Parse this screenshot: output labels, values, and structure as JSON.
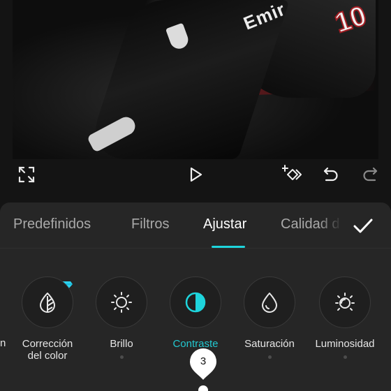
{
  "preview": {
    "jersey_text": "Emir",
    "jersey_number": "10"
  },
  "toolbar": {
    "fullscreen_icon": "fullscreen-icon",
    "play_icon": "play-icon",
    "keyframe_icon": "add-keyframe-icon",
    "undo_icon": "undo-icon",
    "redo_icon": "redo-icon"
  },
  "tabs": [
    {
      "label": "Predefinidos",
      "active": false
    },
    {
      "label": "Filtros",
      "active": false
    },
    {
      "label": "Ajustar",
      "active": true
    },
    {
      "label": "Calidad d",
      "active": false
    }
  ],
  "confirm_icon": "check-icon",
  "tools": {
    "partial_label": "n",
    "items": [
      {
        "label_line1": "Corrección",
        "label_line2": "del color",
        "icon": "color-correction-icon",
        "premium": true,
        "active": false
      },
      {
        "label_line1": "Brillo",
        "label_line2": "",
        "icon": "brightness-icon",
        "premium": false,
        "active": false
      },
      {
        "label_line1": "Contraste",
        "label_line2": "",
        "icon": "contrast-icon",
        "premium": false,
        "active": true
      },
      {
        "label_line1": "Saturación",
        "label_line2": "",
        "icon": "saturation-icon",
        "premium": false,
        "active": false
      },
      {
        "label_line1": "Luminosidad",
        "label_line2": "",
        "icon": "luminosity-icon",
        "premium": false,
        "active": false
      }
    ]
  },
  "slider": {
    "value": "3"
  },
  "colors": {
    "accent": "#1ed4dc",
    "panel": "#262626",
    "background": "#141414",
    "premium": "#2cd3f0"
  }
}
